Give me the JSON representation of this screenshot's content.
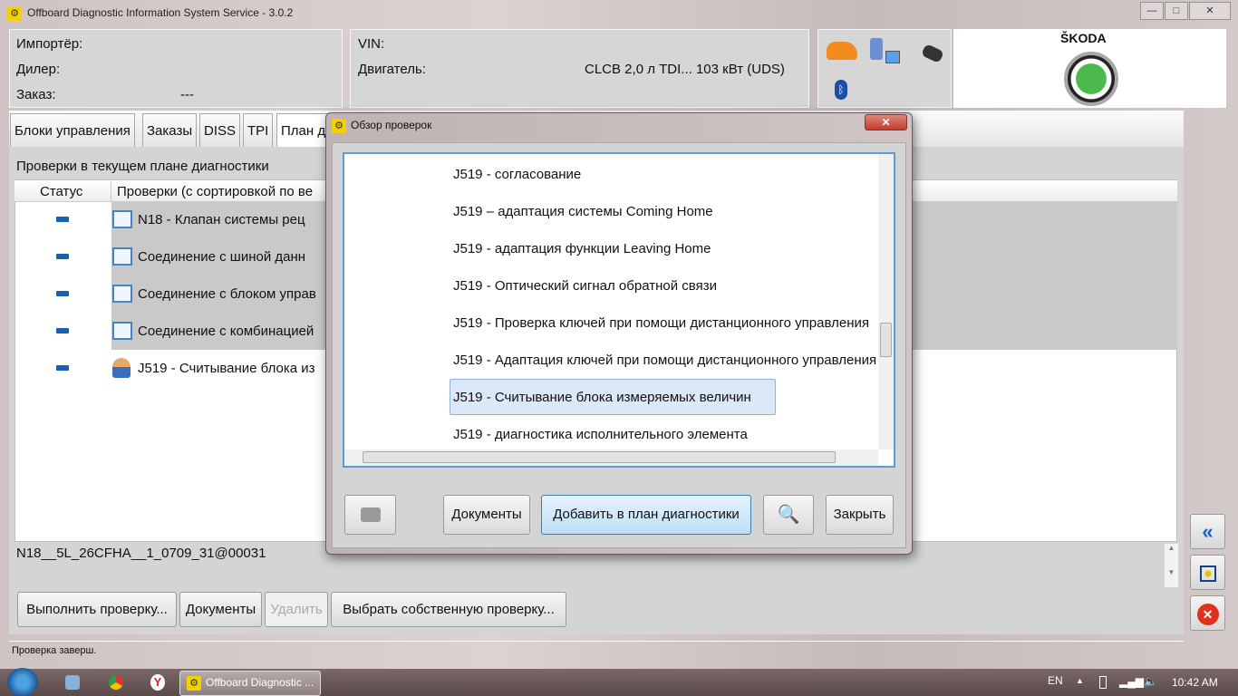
{
  "window": {
    "title": "Offboard Diagnostic Information System Service - 3.0.2",
    "minimize": "—",
    "maximize": "□",
    "close": "✕"
  },
  "header": {
    "importer_label": "Импортёр:",
    "dealer_label": "Дилер:",
    "order_label": "Заказ:",
    "order_value": "---",
    "vin_label": "VIN:",
    "engine_label": "Двигатель:",
    "engine_value": "CLCB 2,0 л TDI... 103 кВт (UDS)",
    "brand": "ŠKODA"
  },
  "tabs": [
    "Блоки управления",
    "Заказы",
    "DISS",
    "TPI",
    "План д"
  ],
  "plan": {
    "heading": "Проверки в текущем плане диагностики",
    "col_status": "Статус",
    "col_checks": "Проверки (с сортировкой по ве",
    "rows": [
      {
        "text": "N18 - Клапан системы рец",
        "icon": "window-icon"
      },
      {
        "text": "Соединение с шиной данн",
        "icon": "window-icon"
      },
      {
        "text": "Соединение с блоком управ",
        "icon": "window-icon"
      },
      {
        "text": "Соединение с комбинацией",
        "icon": "window-icon"
      },
      {
        "text": "J519 - Считывание блока из",
        "icon": "person-icon"
      }
    ],
    "detail": "N18__5L_26CFHA__1_0709_31@00031"
  },
  "buttons": {
    "run": "Выполнить проверку...",
    "docs": "Документы",
    "delete": "Удалить",
    "choose": "Выбрать собственную проверку..."
  },
  "status_text": "Проверка заверш.",
  "dialog": {
    "title": "Обзор проверок",
    "close": "✕",
    "items": [
      "J519 - согласование",
      "J519 – адаптация системы Coming Home",
      "J519 - адаптация функции Leaving Home",
      "J519 - Оптический сигнал обратной связи",
      "J519 - Проверка ключей при помощи дистанционного управления",
      "J519 - Адаптация ключей при помощи дистанционного управления",
      "J519 - Считывание блока измеряемых величин",
      "J519 - диагностика исполнительного элемента"
    ],
    "selected_index": 6,
    "docs": "Документы",
    "add": "Добавить в план диагностики",
    "close_btn": "Закрыть"
  },
  "taskbar": {
    "app": "Offboard Diagnostic ...",
    "lang": "EN",
    "time": "10:42 AM"
  }
}
